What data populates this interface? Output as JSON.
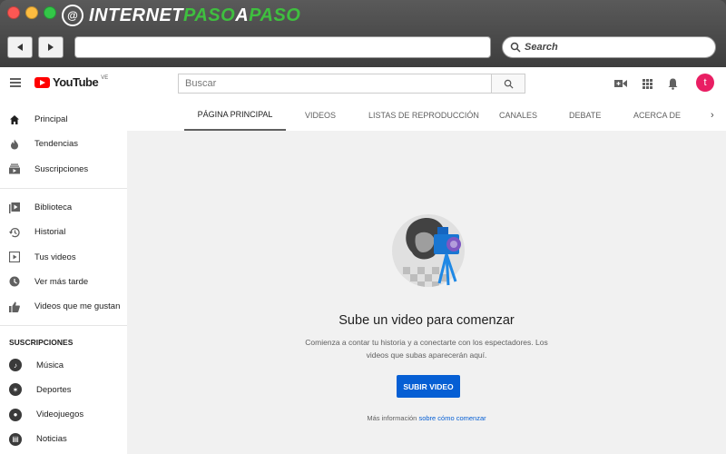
{
  "brand": {
    "logo_letter": "@",
    "name_white_1": "INTERNET",
    "name_green": "PASO",
    "name_white_2": "A",
    "name_green_2": "PASO"
  },
  "browser": {
    "back_icon": "back-arrow-icon",
    "forward_icon": "forward-arrow-icon",
    "search_placeholder": "Search"
  },
  "masthead": {
    "logo_text": "YouTube",
    "region": "VE",
    "search_placeholder": "Buscar",
    "avatar_letter": "t"
  },
  "sidebar": {
    "main_items": [
      {
        "label": "Principal",
        "icon": "home-icon"
      },
      {
        "label": "Tendencias",
        "icon": "flame-icon"
      },
      {
        "label": "Suscripciones",
        "icon": "subscriptions-icon"
      }
    ],
    "library_items": [
      {
        "label": "Biblioteca",
        "icon": "library-icon"
      },
      {
        "label": "Historial",
        "icon": "history-icon"
      },
      {
        "label": "Tus videos",
        "icon": "your-videos-icon"
      },
      {
        "label": "Ver más tarde",
        "icon": "watch-later-icon"
      },
      {
        "label": "Videos que me gustan",
        "icon": "thumbs-up-icon"
      }
    ],
    "subs_heading": "SUSCRIPCIONES",
    "subscriptions": [
      {
        "label": "Música"
      },
      {
        "label": "Deportes"
      },
      {
        "label": "Videojuegos"
      },
      {
        "label": "Noticias"
      }
    ]
  },
  "tabs": [
    {
      "label": "PÁGINA PRINCIPAL",
      "active": true
    },
    {
      "label": "VIDEOS",
      "active": false
    },
    {
      "label": "LISTAS DE REPRODUCCIÓN",
      "active": false
    },
    {
      "label": "CANALES",
      "active": false
    },
    {
      "label": "DEBATE",
      "active": false
    },
    {
      "label": "ACERCA DE",
      "active": false
    }
  ],
  "empty_state": {
    "title": "Sube un video para comenzar",
    "description": "Comienza a contar tu historia y a conectarte con los espectadores. Los videos que subas aparecerán aquí.",
    "button_label": "SUBIR VIDEO",
    "more_info_prefix": "Más información",
    "more_info_link": "sobre cómo comenzar"
  },
  "colors": {
    "accent": "#065fd4",
    "youtube_red": "#ff0000",
    "avatar": "#e91e63",
    "brand_green": "#3fbf3f"
  }
}
